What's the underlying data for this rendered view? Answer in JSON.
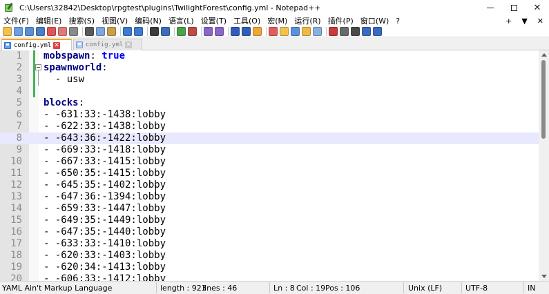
{
  "window": {
    "title": "C:\\Users\\32842\\Desktop\\rpgtest\\plugins\\TwilightForest\\config.yml - Notepad++",
    "min_icon": "minimize-icon",
    "max_icon": "maximize-icon",
    "close_glyph": "✕"
  },
  "menu": {
    "items": [
      "文件(F)",
      "编辑(E)",
      "搜索(S)",
      "视图(V)",
      "编码(N)",
      "语言(L)",
      "设置(T)",
      "工具(O)",
      "宏(M)",
      "运行(R)",
      "插件(P)",
      "窗口(W)",
      "?"
    ],
    "right_plus": "+",
    "right_dropdown": "▼",
    "right_close": "✕"
  },
  "tabs": [
    {
      "label": "config.yml",
      "active": true,
      "close_glyph": "✕"
    },
    {
      "label": "config.yml",
      "active": false,
      "close_glyph": "✕"
    }
  ],
  "editor": {
    "lines": [
      {
        "n": "1",
        "key": "mobspawn",
        "sep": ": ",
        "val": "true",
        "val_kw": true,
        "plain": ""
      },
      {
        "n": "2",
        "key": "spawnworld",
        "sep": ":",
        "val": "",
        "val_kw": false,
        "plain": ""
      },
      {
        "n": "3",
        "key": "",
        "sep": "",
        "val": "",
        "val_kw": false,
        "plain": "  - usw"
      },
      {
        "n": "4",
        "key": "",
        "sep": "",
        "val": "",
        "val_kw": false,
        "plain": ""
      },
      {
        "n": "5",
        "key": "blocks",
        "sep": ":",
        "val": "",
        "val_kw": false,
        "plain": ""
      },
      {
        "n": "6",
        "key": "",
        "sep": "",
        "val": "",
        "val_kw": false,
        "plain": "- -631:33:-1438:lobby"
      },
      {
        "n": "7",
        "key": "",
        "sep": "",
        "val": "",
        "val_kw": false,
        "plain": "- -622:33:-1438:lobby"
      },
      {
        "n": "8",
        "key": "",
        "sep": "",
        "val": "",
        "val_kw": false,
        "plain": "- -643:36:-1422:lobby"
      },
      {
        "n": "9",
        "key": "",
        "sep": "",
        "val": "",
        "val_kw": false,
        "plain": "- -669:33:-1418:lobby"
      },
      {
        "n": "10",
        "key": "",
        "sep": "",
        "val": "",
        "val_kw": false,
        "plain": "- -667:33:-1415:lobby"
      },
      {
        "n": "11",
        "key": "",
        "sep": "",
        "val": "",
        "val_kw": false,
        "plain": "- -650:35:-1415:lobby"
      },
      {
        "n": "12",
        "key": "",
        "sep": "",
        "val": "",
        "val_kw": false,
        "plain": "- -645:35:-1402:lobby"
      },
      {
        "n": "13",
        "key": "",
        "sep": "",
        "val": "",
        "val_kw": false,
        "plain": "- -647:36:-1394:lobby"
      },
      {
        "n": "14",
        "key": "",
        "sep": "",
        "val": "",
        "val_kw": false,
        "plain": "- -659:33:-1447:lobby"
      },
      {
        "n": "15",
        "key": "",
        "sep": "",
        "val": "",
        "val_kw": false,
        "plain": "- -649:35:-1449:lobby"
      },
      {
        "n": "16",
        "key": "",
        "sep": "",
        "val": "",
        "val_kw": false,
        "plain": "- -647:35:-1440:lobby"
      },
      {
        "n": "17",
        "key": "",
        "sep": "",
        "val": "",
        "val_kw": false,
        "plain": "- -633:33:-1410:lobby"
      },
      {
        "n": "18",
        "key": "",
        "sep": "",
        "val": "",
        "val_kw": false,
        "plain": "- -620:33:-1403:lobby"
      },
      {
        "n": "19",
        "key": "",
        "sep": "",
        "val": "",
        "val_kw": false,
        "plain": "- -620:34:-1413:lobby"
      },
      {
        "n": "20",
        "key": "",
        "sep": "",
        "val": "",
        "val_kw": false,
        "plain": "- -606:33:-1412:lobby"
      }
    ],
    "current_line": 8
  },
  "status": {
    "language": "YAML Ain't Markup Language",
    "length": "length : 923",
    "lines": "lines : 46",
    "ln": "Ln : 8",
    "col": "Col : 19",
    "pos": "Pos : 106",
    "eol": "Unix (LF)",
    "encoding": "UTF-8",
    "mode": "IN"
  },
  "colors": {
    "accent_tab": "#f5a623",
    "key": "#000080",
    "keyword": "#0000ff",
    "current_line": "#e8e8ff",
    "change_bar": "#44b556"
  },
  "toolbar_icons": [
    "new-file-icon",
    "open-file-icon",
    "save-icon",
    "save-all-icon",
    "close-icon",
    "close-all-icon",
    "print-icon",
    "cut-icon",
    "copy-icon",
    "paste-icon",
    "undo-icon",
    "redo-icon",
    "find-icon",
    "replace-icon",
    "zoom-in-icon",
    "zoom-out-icon",
    "sync-vertical-icon",
    "sync-horizontal-icon",
    "word-wrap-icon",
    "show-all-chars-icon",
    "indent-guide-icon",
    "language-icon",
    "doc-map-icon",
    "function-list-icon",
    "folder-workspace-icon",
    "monitoring-icon",
    "record-macro-icon",
    "stop-record-icon",
    "play-macro-icon",
    "run-macro-multiple-icon",
    "save-macro-icon"
  ]
}
